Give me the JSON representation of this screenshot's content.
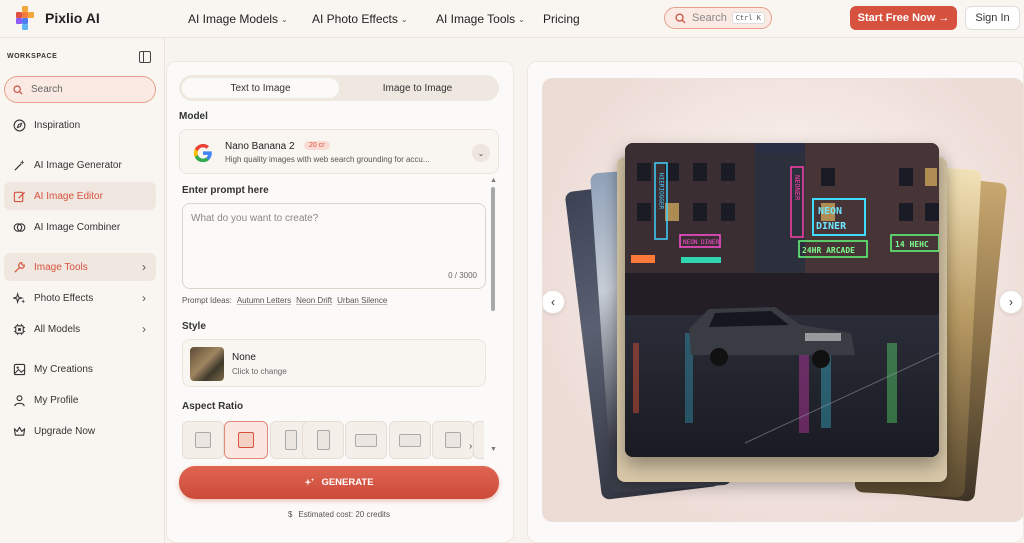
{
  "brand": {
    "name": "Pixlio AI"
  },
  "topnav": {
    "items": [
      {
        "label": "AI Image Models",
        "dropdown": true
      },
      {
        "label": "AI Photo Effects",
        "dropdown": true
      },
      {
        "label": "AI Image Tools",
        "dropdown": true
      },
      {
        "label": "Pricing",
        "dropdown": false
      }
    ],
    "search_placeholder": "Search",
    "search_shortcut": "Ctrl K",
    "start_label": "Start Free Now →",
    "signin_label": "Sign In"
  },
  "sidebar": {
    "workspace_label": "WORKSPACE",
    "search_placeholder": "Search",
    "items": [
      {
        "label": "Inspiration",
        "icon": "compass-icon"
      },
      {
        "label": "AI Image Generator",
        "icon": "magic-wand-icon"
      },
      {
        "label": "AI Image Editor",
        "icon": "edit-icon",
        "active": true
      },
      {
        "label": "AI Image Combiner",
        "icon": "combine-icon"
      },
      {
        "label": "Image Tools",
        "icon": "wrench-icon",
        "expandable": true
      },
      {
        "label": "Photo Effects",
        "icon": "sparkle-icon",
        "expandable": true
      },
      {
        "label": "All Models",
        "icon": "chip-icon",
        "expandable": true
      },
      {
        "label": "My Creations",
        "icon": "image-icon"
      },
      {
        "label": "My Profile",
        "icon": "user-icon"
      },
      {
        "label": "Upgrade Now",
        "icon": "crown-icon"
      }
    ]
  },
  "generator": {
    "tabs": [
      "Text to Image",
      "Image to Image"
    ],
    "model_label": "Model",
    "model": {
      "name": "Nano Banana 2",
      "badge": "20 cr",
      "description": "High quality images with web search grounding for accu..."
    },
    "prompt_label": "Enter prompt here",
    "prompt_placeholder": "What do you want to create?",
    "prompt_count": "0 / 3000",
    "ideas_label": "Prompt Ideas:",
    "ideas": [
      "Autumn Letters",
      "Neon Drift",
      "Urban Silence"
    ],
    "style_label": "Style",
    "style": {
      "name": "None",
      "sub": "Click to change"
    },
    "aspect_label": "Aspect Ratio",
    "generate_label": "GENERATE",
    "cost_label": "Estimated cost: 20 credits"
  },
  "preview": {
    "neon_signs": [
      "HIERIOGGER",
      "NEON DINER",
      "24HR ARCADE",
      "NEONER",
      "14 HEHC"
    ]
  },
  "colors": {
    "accent": "#d6523f",
    "background": "#f7f3ef"
  }
}
